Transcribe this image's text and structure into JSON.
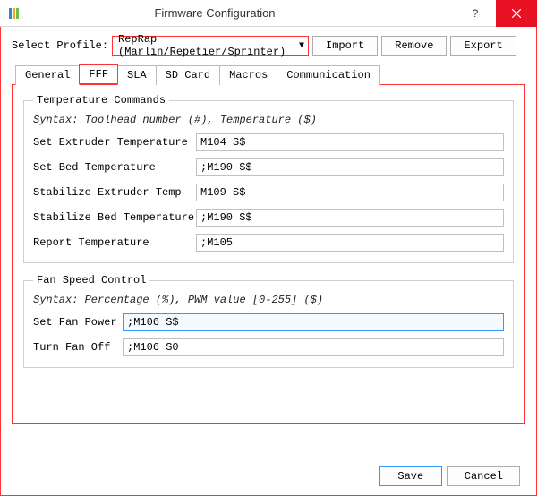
{
  "window": {
    "title": "Firmware Configuration"
  },
  "profile": {
    "label": "Select Profile:",
    "selected": "RepRap (Marlin/Repetier/Sprinter)",
    "import_label": "Import",
    "remove_label": "Remove",
    "export_label": "Export"
  },
  "tabs": {
    "general": "General",
    "fff": "FFF",
    "sla": "SLA",
    "sdcard": "SD Card",
    "macros": "Macros",
    "communication": "Communication"
  },
  "temperature": {
    "legend": "Temperature Commands",
    "syntax": "Syntax: Toolhead number (#), Temperature ($)",
    "set_extruder_label": "Set Extruder Temperature",
    "set_extruder_value": "M104 S$",
    "set_bed_label": "Set Bed Temperature",
    "set_bed_value": ";M190 S$",
    "stabilize_extruder_label": "Stabilize Extruder Temp",
    "stabilize_extruder_value": "M109 S$",
    "stabilize_bed_label": "Stabilize Bed Temperature",
    "stabilize_bed_value": ";M190 S$",
    "report_label": "Report Temperature",
    "report_value": ";M105"
  },
  "fan": {
    "legend": "Fan Speed Control",
    "syntax": "Syntax: Percentage (%), PWM value [0-255] ($)",
    "set_power_label": "Set Fan Power",
    "set_power_value": ";M106 S$",
    "turn_off_label": "Turn Fan Off",
    "turn_off_value": ";M106 S0"
  },
  "footer": {
    "save_label": "Save",
    "cancel_label": "Cancel"
  }
}
